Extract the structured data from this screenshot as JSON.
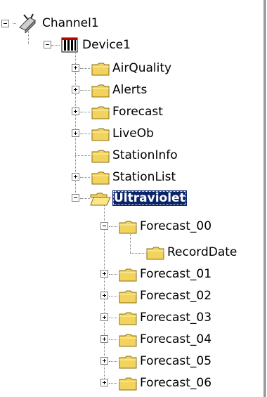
{
  "tree": {
    "channel": {
      "label": "Channel1",
      "state": "expanded"
    },
    "device": {
      "label": "Device1",
      "state": "expanded"
    },
    "groups": [
      {
        "label": "AirQuality",
        "state": "collapsed"
      },
      {
        "label": "Alerts",
        "state": "collapsed"
      },
      {
        "label": "Forecast",
        "state": "collapsed"
      },
      {
        "label": "LiveOb",
        "state": "collapsed"
      },
      {
        "label": "StationInfo",
        "state": "leaf"
      },
      {
        "label": "StationList",
        "state": "collapsed"
      },
      {
        "label": "Ultraviolet",
        "state": "expanded",
        "selected": true
      }
    ],
    "ultraviolet_children": [
      {
        "label": "Forecast_00",
        "state": "expanded"
      },
      {
        "label": "RecordDate",
        "state": "leaf",
        "parent": "Forecast_00"
      },
      {
        "label": "Forecast_01",
        "state": "collapsed"
      },
      {
        "label": "Forecast_02",
        "state": "collapsed"
      },
      {
        "label": "Forecast_03",
        "state": "collapsed"
      },
      {
        "label": "Forecast_04",
        "state": "collapsed"
      },
      {
        "label": "Forecast_05",
        "state": "collapsed"
      },
      {
        "label": "Forecast_06",
        "state": "collapsed"
      }
    ]
  },
  "colors": {
    "selection_bg": "#0a246a",
    "selection_text": "#ffffff",
    "folder": "#f2d35e",
    "connector": "#808080"
  }
}
